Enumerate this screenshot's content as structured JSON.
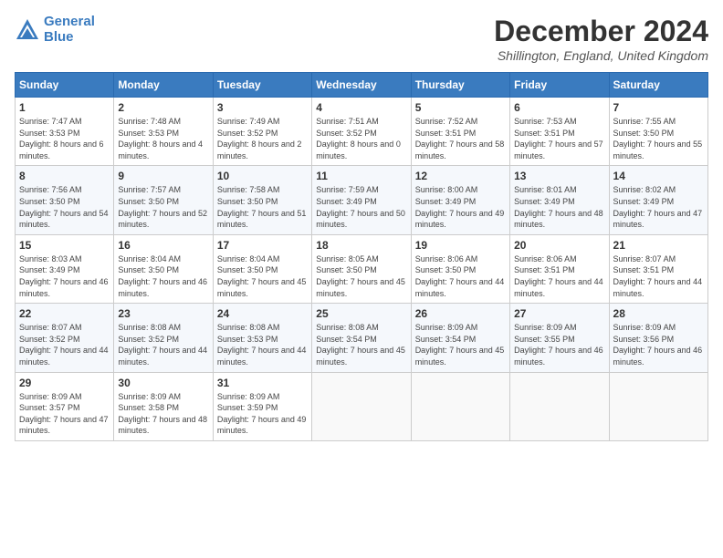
{
  "logo": {
    "line1": "General",
    "line2": "Blue"
  },
  "title": "December 2024",
  "location": "Shillington, England, United Kingdom",
  "headers": [
    "Sunday",
    "Monday",
    "Tuesday",
    "Wednesday",
    "Thursday",
    "Friday",
    "Saturday"
  ],
  "weeks": [
    [
      {
        "day": "1",
        "sunrise": "Sunrise: 7:47 AM",
        "sunset": "Sunset: 3:53 PM",
        "daylight": "Daylight: 8 hours and 6 minutes."
      },
      {
        "day": "2",
        "sunrise": "Sunrise: 7:48 AM",
        "sunset": "Sunset: 3:53 PM",
        "daylight": "Daylight: 8 hours and 4 minutes."
      },
      {
        "day": "3",
        "sunrise": "Sunrise: 7:49 AM",
        "sunset": "Sunset: 3:52 PM",
        "daylight": "Daylight: 8 hours and 2 minutes."
      },
      {
        "day": "4",
        "sunrise": "Sunrise: 7:51 AM",
        "sunset": "Sunset: 3:52 PM",
        "daylight": "Daylight: 8 hours and 0 minutes."
      },
      {
        "day": "5",
        "sunrise": "Sunrise: 7:52 AM",
        "sunset": "Sunset: 3:51 PM",
        "daylight": "Daylight: 7 hours and 58 minutes."
      },
      {
        "day": "6",
        "sunrise": "Sunrise: 7:53 AM",
        "sunset": "Sunset: 3:51 PM",
        "daylight": "Daylight: 7 hours and 57 minutes."
      },
      {
        "day": "7",
        "sunrise": "Sunrise: 7:55 AM",
        "sunset": "Sunset: 3:50 PM",
        "daylight": "Daylight: 7 hours and 55 minutes."
      }
    ],
    [
      {
        "day": "8",
        "sunrise": "Sunrise: 7:56 AM",
        "sunset": "Sunset: 3:50 PM",
        "daylight": "Daylight: 7 hours and 54 minutes."
      },
      {
        "day": "9",
        "sunrise": "Sunrise: 7:57 AM",
        "sunset": "Sunset: 3:50 PM",
        "daylight": "Daylight: 7 hours and 52 minutes."
      },
      {
        "day": "10",
        "sunrise": "Sunrise: 7:58 AM",
        "sunset": "Sunset: 3:50 PM",
        "daylight": "Daylight: 7 hours and 51 minutes."
      },
      {
        "day": "11",
        "sunrise": "Sunrise: 7:59 AM",
        "sunset": "Sunset: 3:49 PM",
        "daylight": "Daylight: 7 hours and 50 minutes."
      },
      {
        "day": "12",
        "sunrise": "Sunrise: 8:00 AM",
        "sunset": "Sunset: 3:49 PM",
        "daylight": "Daylight: 7 hours and 49 minutes."
      },
      {
        "day": "13",
        "sunrise": "Sunrise: 8:01 AM",
        "sunset": "Sunset: 3:49 PM",
        "daylight": "Daylight: 7 hours and 48 minutes."
      },
      {
        "day": "14",
        "sunrise": "Sunrise: 8:02 AM",
        "sunset": "Sunset: 3:49 PM",
        "daylight": "Daylight: 7 hours and 47 minutes."
      }
    ],
    [
      {
        "day": "15",
        "sunrise": "Sunrise: 8:03 AM",
        "sunset": "Sunset: 3:49 PM",
        "daylight": "Daylight: 7 hours and 46 minutes."
      },
      {
        "day": "16",
        "sunrise": "Sunrise: 8:04 AM",
        "sunset": "Sunset: 3:50 PM",
        "daylight": "Daylight: 7 hours and 46 minutes."
      },
      {
        "day": "17",
        "sunrise": "Sunrise: 8:04 AM",
        "sunset": "Sunset: 3:50 PM",
        "daylight": "Daylight: 7 hours and 45 minutes."
      },
      {
        "day": "18",
        "sunrise": "Sunrise: 8:05 AM",
        "sunset": "Sunset: 3:50 PM",
        "daylight": "Daylight: 7 hours and 45 minutes."
      },
      {
        "day": "19",
        "sunrise": "Sunrise: 8:06 AM",
        "sunset": "Sunset: 3:50 PM",
        "daylight": "Daylight: 7 hours and 44 minutes."
      },
      {
        "day": "20",
        "sunrise": "Sunrise: 8:06 AM",
        "sunset": "Sunset: 3:51 PM",
        "daylight": "Daylight: 7 hours and 44 minutes."
      },
      {
        "day": "21",
        "sunrise": "Sunrise: 8:07 AM",
        "sunset": "Sunset: 3:51 PM",
        "daylight": "Daylight: 7 hours and 44 minutes."
      }
    ],
    [
      {
        "day": "22",
        "sunrise": "Sunrise: 8:07 AM",
        "sunset": "Sunset: 3:52 PM",
        "daylight": "Daylight: 7 hours and 44 minutes."
      },
      {
        "day": "23",
        "sunrise": "Sunrise: 8:08 AM",
        "sunset": "Sunset: 3:52 PM",
        "daylight": "Daylight: 7 hours and 44 minutes."
      },
      {
        "day": "24",
        "sunrise": "Sunrise: 8:08 AM",
        "sunset": "Sunset: 3:53 PM",
        "daylight": "Daylight: 7 hours and 44 minutes."
      },
      {
        "day": "25",
        "sunrise": "Sunrise: 8:08 AM",
        "sunset": "Sunset: 3:54 PM",
        "daylight": "Daylight: 7 hours and 45 minutes."
      },
      {
        "day": "26",
        "sunrise": "Sunrise: 8:09 AM",
        "sunset": "Sunset: 3:54 PM",
        "daylight": "Daylight: 7 hours and 45 minutes."
      },
      {
        "day": "27",
        "sunrise": "Sunrise: 8:09 AM",
        "sunset": "Sunset: 3:55 PM",
        "daylight": "Daylight: 7 hours and 46 minutes."
      },
      {
        "day": "28",
        "sunrise": "Sunrise: 8:09 AM",
        "sunset": "Sunset: 3:56 PM",
        "daylight": "Daylight: 7 hours and 46 minutes."
      }
    ],
    [
      {
        "day": "29",
        "sunrise": "Sunrise: 8:09 AM",
        "sunset": "Sunset: 3:57 PM",
        "daylight": "Daylight: 7 hours and 47 minutes."
      },
      {
        "day": "30",
        "sunrise": "Sunrise: 8:09 AM",
        "sunset": "Sunset: 3:58 PM",
        "daylight": "Daylight: 7 hours and 48 minutes."
      },
      {
        "day": "31",
        "sunrise": "Sunrise: 8:09 AM",
        "sunset": "Sunset: 3:59 PM",
        "daylight": "Daylight: 7 hours and 49 minutes."
      },
      null,
      null,
      null,
      null
    ]
  ]
}
